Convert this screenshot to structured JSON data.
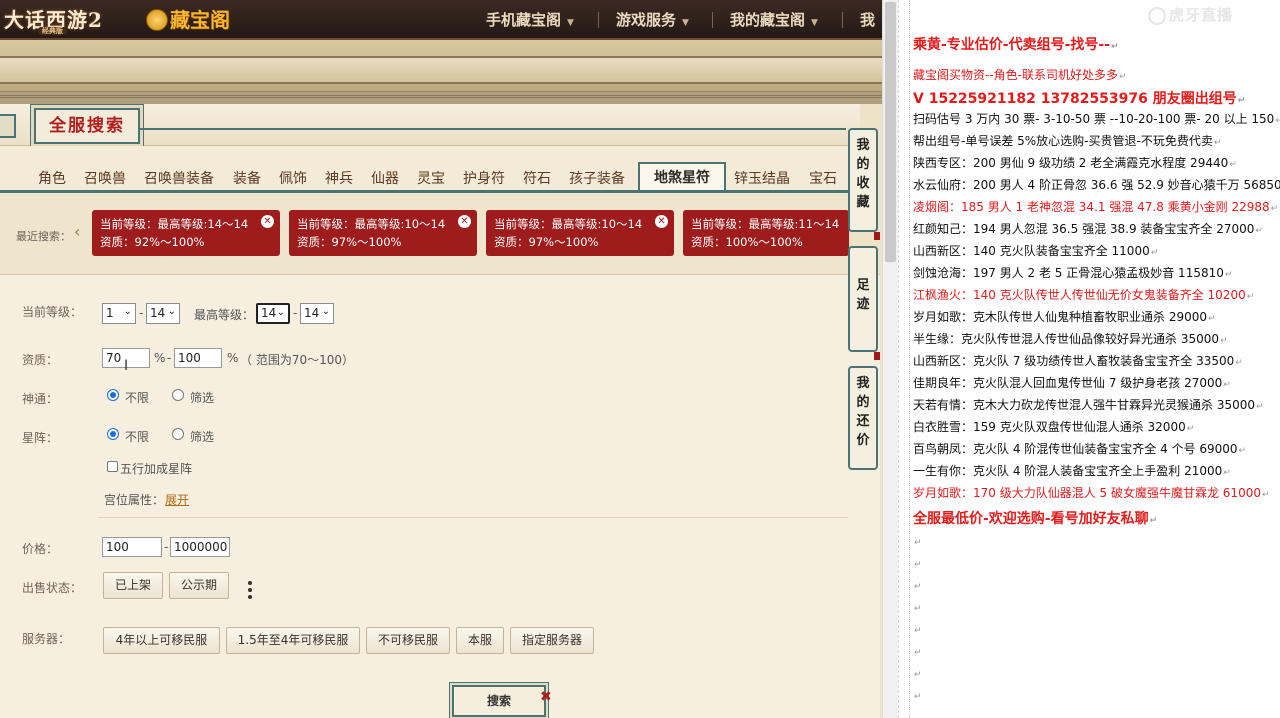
{
  "top_nav": {
    "game_logo": "大话西游2",
    "game_logo_sub": "经典版",
    "cbg_logo": "藏宝阁",
    "items": [
      {
        "label": "手机藏宝阁"
      },
      {
        "label": "游戏服务"
      },
      {
        "label": "我的藏宝阁"
      },
      {
        "label": "我的"
      }
    ]
  },
  "search_title": "全服搜索",
  "category_tabs": [
    "角色",
    "召唤兽",
    "召唤兽装备",
    "装备",
    "佩饰",
    "神兵",
    "仙器",
    "灵宝",
    "护身符",
    "符石",
    "孩子装备",
    "地煞星符",
    "锌玉结晶",
    "宝石"
  ],
  "active_tab": "地煞星符",
  "recent": {
    "label": "最近搜索：",
    "chips": [
      {
        "line1": "当前等级：最高等级:14～14",
        "line2": "资质：92%～100%"
      },
      {
        "line1": "当前等级：最高等级:10～14",
        "line2": "资质：97%～100%"
      },
      {
        "line1": "当前等级：最高等级:10～14",
        "line2": "资质：97%～100%"
      },
      {
        "line1": "当前等级：最高等级:11～14",
        "line2": "资质：100%～100%"
      }
    ]
  },
  "form": {
    "level_label": "当前等级：",
    "level_from": "1",
    "level_to": "14",
    "max_level_label": "最高等级：",
    "max_level_from": "14",
    "max_level_to": "14",
    "dash": "-",
    "aptitude_label": "资质：",
    "aptitude_from": "70",
    "aptitude_to": "100",
    "percent": "%",
    "aptitude_range": "（ 范围为70～100）",
    "divine_label": "神通：",
    "starfield_label": "星阵：",
    "opt_unlimited": "不限",
    "opt_filter": "筛选",
    "five_elements": "五行加成星阵",
    "palace_label": "宫位属性：",
    "expand": "展开",
    "price_label": "价格：",
    "price_from": "100",
    "price_to": "1000000",
    "sale_status_label": "出售状态：",
    "sale_buttons": [
      "已上架",
      "公示期"
    ],
    "server_label": "服务器：",
    "server_buttons": [
      "4年以上可移民服",
      "1.5年至4年可移民服",
      "不可移民服",
      "本服",
      "指定服务器"
    ],
    "search_button": "搜索"
  },
  "side_tabs": [
    "我的收藏",
    "足迹",
    "我的还价"
  ],
  "notes": {
    "watermark": "虎牙直播",
    "lines": [
      {
        "text": "乘黄-专业估价-代卖组号-找号--",
        "color": "#e41b1b",
        "big": true
      },
      {
        "text": "藏宝阁买物资--角色-联系司机好处多多",
        "color": "#e41b1b"
      },
      {
        "text": "V 15225921182   13782553976 朋友圈出组号",
        "color": "#e41b1b",
        "big": true
      },
      {
        "text": "扫码估号 3 万内 30 票- 3-10-50 票  --10-20-100 票- 20 以上 150",
        "color": "#111"
      },
      {
        "text": "帮出组号-单号误差 5%放心选购-买贵管退-不玩免费代卖",
        "color": "#111"
      },
      {
        "text": "陕西专区：200 男仙 9 级功绩 2 老全满霞克水程度 29440",
        "color": "#111"
      },
      {
        "text": "水云仙府：200 男人 4 阶正骨忽 36.6 强 52.9 妙音心猿千万 56850",
        "color": "#111"
      },
      {
        "text": "凌烟阁：185 男人 1 老神忽混 34.1 强混 47.8 乘黄小金刚 22988",
        "color": "#e41b1b"
      },
      {
        "text": "红颜知己：194 男人忽混 36.5 强混 38.9 装备宝宝齐全 27000",
        "color": "#111"
      },
      {
        "text": "山西新区：140 克火队装备宝宝齐全 11000",
        "color": "#111"
      },
      {
        "text": "剑蚀沧海：197 男人 2 老 5 正骨混心猿孟极妙音 115810",
        "color": "#111"
      },
      {
        "text": "江枫渔火：140 克火队传世人传世仙无价女鬼装备齐全 10200",
        "color": "#e41b1b"
      },
      {
        "text": "岁月如歌：克木队传世人仙鬼种植畜牧职业通杀 29000",
        "color": "#111"
      },
      {
        "text": "半生缘：克火队传世混人传世仙品像较好异光通杀 35000",
        "color": "#111"
      },
      {
        "text": "山西新区：克火队 7 级功绩传世人畜牧装备宝宝齐全 33500",
        "color": "#111"
      },
      {
        "text": "佳期良年：克火队混人回血鬼传世仙 7 级护身老孩 27000",
        "color": "#111"
      },
      {
        "text": "天若有情：克木大力砍龙传世混人强牛甘霖异光灵猴通杀 35000",
        "color": "#111"
      },
      {
        "text": "白衣胜雪：159 克火队双盘传世仙混人通杀 32000",
        "color": "#111"
      },
      {
        "text": "百鸟朝凤：克火队 4 阶混传世仙装备宝宝齐全 4 个号 69000",
        "color": "#111"
      },
      {
        "text": "一生有你：克火队 4 阶混人装备宝宝齐全上手盈利 21000",
        "color": "#111"
      },
      {
        "text": "岁月如歌：170 级大力队仙器混人 5 破女魔强牛魔甘霖龙 61000",
        "color": "#e41b1b"
      },
      {
        "text": "全服最低价-欢迎选购-看号加好友私聊",
        "color": "#e41b1b",
        "big": true
      }
    ]
  }
}
